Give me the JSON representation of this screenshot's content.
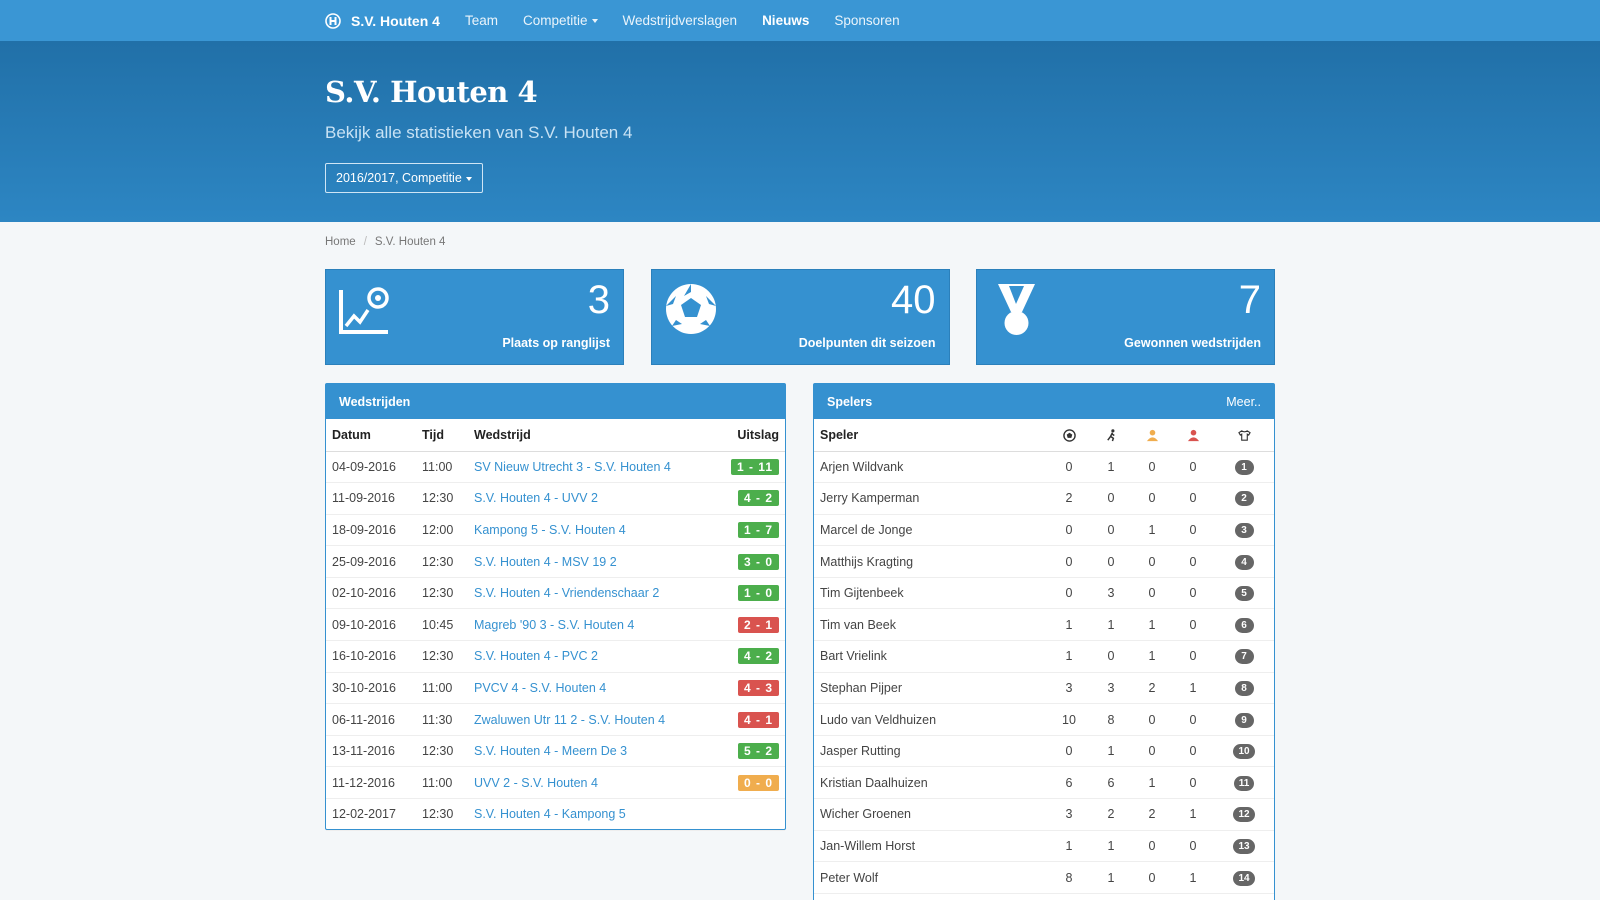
{
  "nav": {
    "brand": "S.V. Houten 4",
    "items": [
      {
        "label": "Team"
      },
      {
        "label": "Competitie"
      },
      {
        "label": "Wedstrijdverslagen"
      },
      {
        "label": "Nieuws"
      },
      {
        "label": "Sponsoren"
      }
    ]
  },
  "hero": {
    "title": "S.V. Houten 4",
    "subtitle": "Bekijk alle statistieken van S.V. Houten 4",
    "season": "2016/2017, Competitie"
  },
  "breadcrumb": {
    "home": "Home",
    "current": "S.V. Houten 4"
  },
  "stats": [
    {
      "value": "3",
      "label": "Plaats op ranglijst",
      "icon": "ranking-chart-icon"
    },
    {
      "value": "40",
      "label": "Doelpunten dit seizoen",
      "icon": "soccer-ball-icon"
    },
    {
      "value": "7",
      "label": "Gewonnen wedstrijden",
      "icon": "medal-icon"
    }
  ],
  "matches": {
    "title": "Wedstrijden",
    "headers": {
      "date": "Datum",
      "time": "Tijd",
      "match": "Wedstrijd",
      "result": "Uitslag"
    },
    "rows": [
      {
        "date": "04-09-2016",
        "time": "11:00",
        "match": "SV Nieuw Utrecht 3 - S.V. Houten 4",
        "score": "1 - 11",
        "color": "#4cae4c"
      },
      {
        "date": "11-09-2016",
        "time": "12:30",
        "match": "S.V. Houten 4 - UVV 2",
        "score": "4 - 2",
        "color": "#4cae4c"
      },
      {
        "date": "18-09-2016",
        "time": "12:00",
        "match": "Kampong 5 - S.V. Houten 4",
        "score": "1 - 7",
        "color": "#4cae4c"
      },
      {
        "date": "25-09-2016",
        "time": "12:30",
        "match": "S.V. Houten 4 - MSV 19 2",
        "score": "3 - 0",
        "color": "#4cae4c"
      },
      {
        "date": "02-10-2016",
        "time": "12:30",
        "match": "S.V. Houten 4 - Vriendenschaar 2",
        "score": "1 - 0",
        "color": "#4cae4c"
      },
      {
        "date": "09-10-2016",
        "time": "10:45",
        "match": "Magreb '90 3 - S.V. Houten 4",
        "score": "2 - 1",
        "color": "#d9534f"
      },
      {
        "date": "16-10-2016",
        "time": "12:30",
        "match": "S.V. Houten 4 - PVC 2",
        "score": "4 - 2",
        "color": "#4cae4c"
      },
      {
        "date": "30-10-2016",
        "time": "11:00",
        "match": "PVCV 4 - S.V. Houten 4",
        "score": "4 - 3",
        "color": "#d9534f"
      },
      {
        "date": "06-11-2016",
        "time": "11:30",
        "match": "Zwaluwen Utr 11 2 - S.V. Houten 4",
        "score": "4 - 1",
        "color": "#d9534f"
      },
      {
        "date": "13-11-2016",
        "time": "12:30",
        "match": "S.V. Houten 4 - Meern De 3",
        "score": "5 - 2",
        "color": "#4cae4c"
      },
      {
        "date": "11-12-2016",
        "time": "11:00",
        "match": "UVV 2 - S.V. Houten 4",
        "score": "0 - 0",
        "color": "#f0ad4e"
      },
      {
        "date": "12-02-2017",
        "time": "12:30",
        "match": "S.V. Houten 4 - Kampong 5",
        "score": "",
        "color": ""
      }
    ]
  },
  "players": {
    "title": "Spelers",
    "more": "Meer..",
    "header": "Speler",
    "rows": [
      {
        "name": "Arjen Wildvank",
        "goals": "0",
        "assists": "1",
        "yellow": "0",
        "red": "0",
        "number": "1"
      },
      {
        "name": "Jerry Kamperman",
        "goals": "2",
        "assists": "0",
        "yellow": "0",
        "red": "0",
        "number": "2"
      },
      {
        "name": "Marcel de Jonge",
        "goals": "0",
        "assists": "0",
        "yellow": "1",
        "red": "0",
        "number": "3"
      },
      {
        "name": "Matthijs Kragting",
        "goals": "0",
        "assists": "0",
        "yellow": "0",
        "red": "0",
        "number": "4"
      },
      {
        "name": "Tim Gijtenbeek",
        "goals": "0",
        "assists": "3",
        "yellow": "0",
        "red": "0",
        "number": "5"
      },
      {
        "name": "Tim van Beek",
        "goals": "1",
        "assists": "1",
        "yellow": "1",
        "red": "0",
        "number": "6"
      },
      {
        "name": "Bart Vrielink",
        "goals": "1",
        "assists": "0",
        "yellow": "1",
        "red": "0",
        "number": "7"
      },
      {
        "name": "Stephan Pijper",
        "goals": "3",
        "assists": "3",
        "yellow": "2",
        "red": "1",
        "number": "8"
      },
      {
        "name": "Ludo van Veldhuizen",
        "goals": "10",
        "assists": "8",
        "yellow": "0",
        "red": "0",
        "number": "9"
      },
      {
        "name": "Jasper Rutting",
        "goals": "0",
        "assists": "1",
        "yellow": "0",
        "red": "0",
        "number": "10"
      },
      {
        "name": "Kristian Daalhuizen",
        "goals": "6",
        "assists": "6",
        "yellow": "1",
        "red": "0",
        "number": "11"
      },
      {
        "name": "Wicher Groenen",
        "goals": "3",
        "assists": "2",
        "yellow": "2",
        "red": "1",
        "number": "12"
      },
      {
        "name": "Jan-Willem Horst",
        "goals": "1",
        "assists": "1",
        "yellow": "0",
        "red": "0",
        "number": "13"
      },
      {
        "name": "Peter Wolf",
        "goals": "8",
        "assists": "1",
        "yellow": "0",
        "red": "1",
        "number": "14"
      }
    ]
  },
  "colors": {
    "primary": "#3591d0",
    "win": "#4cae4c",
    "loss": "#d9534f",
    "draw": "#f0ad4e",
    "yellow_card": "#f0ad4e",
    "red_card": "#d9534f"
  }
}
